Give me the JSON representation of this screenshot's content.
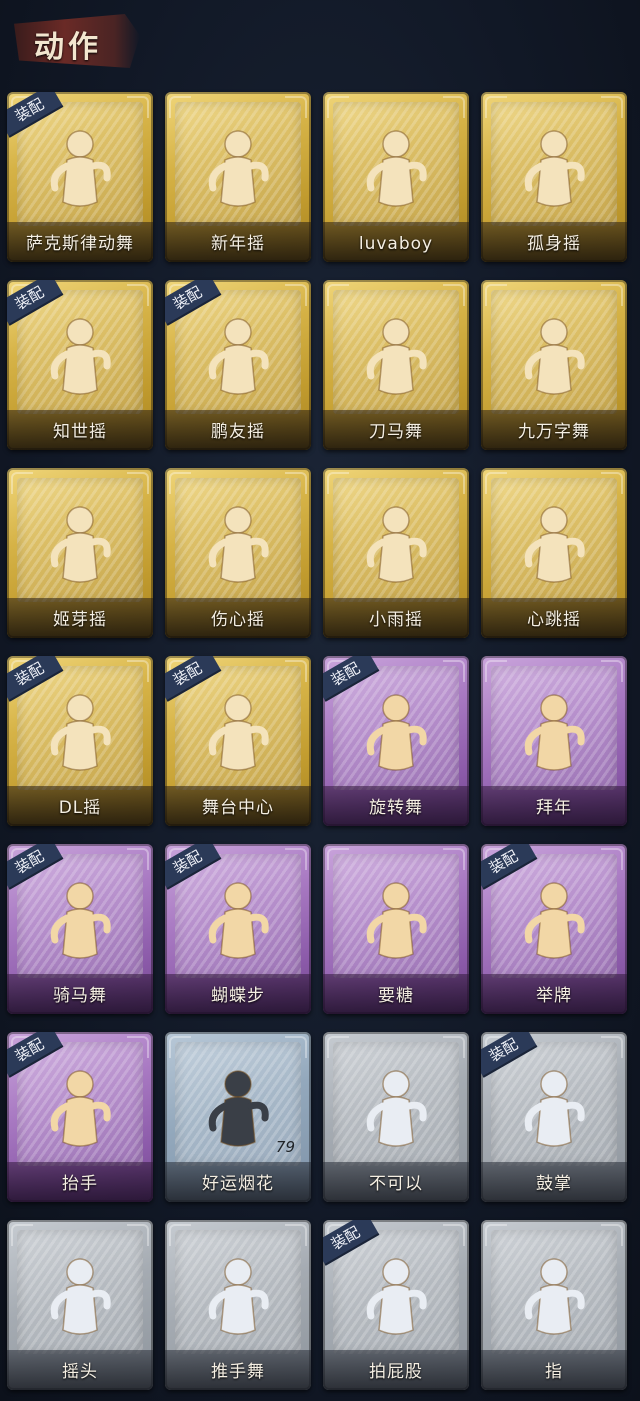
{
  "header": {
    "title": "动作"
  },
  "badge_label": "装配",
  "colors": {
    "gold": "#d6b347",
    "purple": "#a879c2",
    "blue": "#93a8bc",
    "gray": "#a5abb2",
    "badge": "#2b3a58"
  },
  "cards": [
    {
      "label": "萨克斯律动舞",
      "rarity": "gold",
      "equipped": true,
      "icon": "saxophone-dance-icon"
    },
    {
      "label": "新年摇",
      "rarity": "gold",
      "equipped": false,
      "icon": "new-year-dance-icon"
    },
    {
      "label": "luvaboy",
      "rarity": "gold",
      "equipped": false,
      "icon": "luvaboy-dance-icon"
    },
    {
      "label": "孤身摇",
      "rarity": "gold",
      "equipped": false,
      "icon": "solo-dance-icon"
    },
    {
      "label": "知世摇",
      "rarity": "gold",
      "equipped": true,
      "icon": "music-dance-icon"
    },
    {
      "label": "鹏友摇",
      "rarity": "gold",
      "equipped": true,
      "icon": "point-dance-icon"
    },
    {
      "label": "刀马舞",
      "rarity": "gold",
      "equipped": false,
      "icon": "blade-dance-icon"
    },
    {
      "label": "九万字舞",
      "rarity": "gold",
      "equipped": false,
      "icon": "swirl-dance-icon"
    },
    {
      "label": "姬芽摇",
      "rarity": "gold",
      "equipped": false,
      "icon": "music-sway-icon"
    },
    {
      "label": "伤心摇",
      "rarity": "gold",
      "equipped": false,
      "icon": "heart-hands-icon"
    },
    {
      "label": "小雨摇",
      "rarity": "gold",
      "equipped": false,
      "icon": "rain-sway-icon"
    },
    {
      "label": "心跳摇",
      "rarity": "gold",
      "equipped": false,
      "icon": "heartbeat-sway-icon"
    },
    {
      "label": "DL摇",
      "rarity": "gold",
      "equipped": true,
      "icon": "arm-raise-dance-icon"
    },
    {
      "label": "舞台中心",
      "rarity": "gold",
      "equipped": true,
      "icon": "stage-center-icon"
    },
    {
      "label": "旋转舞",
      "rarity": "purple",
      "equipped": true,
      "icon": "spin-dance-icon"
    },
    {
      "label": "拜年",
      "rarity": "purple",
      "equipped": false,
      "icon": "greeting-bow-icon"
    },
    {
      "label": "骑马舞",
      "rarity": "purple",
      "equipped": true,
      "icon": "horse-dance-icon"
    },
    {
      "label": "蝴蝶步",
      "rarity": "purple",
      "equipped": true,
      "icon": "butterfly-step-icon"
    },
    {
      "label": "要糖",
      "rarity": "purple",
      "equipped": false,
      "icon": "ask-candy-icon"
    },
    {
      "label": "举牌",
      "rarity": "purple",
      "equipped": true,
      "icon": "hold-sign-icon"
    },
    {
      "label": "抬手",
      "rarity": "purple",
      "equipped": true,
      "icon": "raise-hand-icon"
    },
    {
      "label": "好运烟花",
      "rarity": "blue",
      "equipped": false,
      "icon": "firework-icon",
      "count": "79"
    },
    {
      "label": "不可以",
      "rarity": "gray",
      "equipped": false,
      "icon": "finger-wag-icon"
    },
    {
      "label": "鼓掌",
      "rarity": "gray",
      "equipped": true,
      "icon": "clap-icon"
    },
    {
      "label": "摇头",
      "rarity": "gray",
      "equipped": false,
      "icon": "head-shake-icon"
    },
    {
      "label": "推手舞",
      "rarity": "gray",
      "equipped": false,
      "icon": "push-hands-icon"
    },
    {
      "label": "拍屁股",
      "rarity": "gray",
      "equipped": true,
      "icon": "butt-slap-icon"
    },
    {
      "label": "指",
      "rarity": "gray",
      "equipped": false,
      "icon": "point-finger-icon"
    }
  ]
}
